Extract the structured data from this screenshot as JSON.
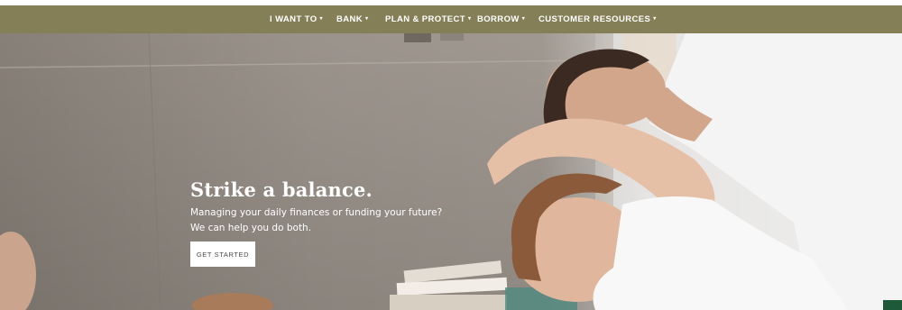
{
  "nav": {
    "items": [
      {
        "label": "I WANT TO",
        "caret": "▾"
      },
      {
        "label": "BANK",
        "caret": "▾"
      },
      {
        "label": "PLAN & PROTECT",
        "caret": "▾"
      },
      {
        "label": "BORROW",
        "caret": "▾"
      },
      {
        "label": "CUSTOMER RESOURCES",
        "caret": "▾"
      }
    ]
  },
  "hero": {
    "headline": "Strike a balance.",
    "subtext_line1": "Managing your daily finances or funding your future?",
    "subtext_line2": "We can help you do both.",
    "cta_label": "GET STARTED"
  },
  "colors": {
    "nav_background": "#857f57",
    "nav_text": "#ffffff",
    "cta_background": "#ffffff",
    "accent_green": "#1e5a3a"
  }
}
